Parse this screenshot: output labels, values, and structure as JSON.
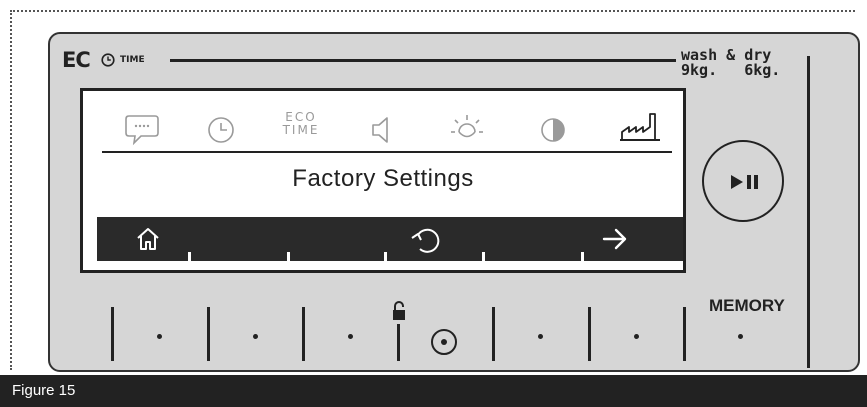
{
  "header": {
    "eco_logo": "EC",
    "eco_time_label": "TIME",
    "wash_dry_title": "wash & dry",
    "capacity_line": "9kg.   6kg."
  },
  "screen": {
    "icons": [
      "chat-bubble-icon",
      "clock-icon",
      "eco-time-icon",
      "speaker-icon",
      "brightness-icon",
      "contrast-icon",
      "factory-icon"
    ],
    "eco_time_icon_text_1": "ECO",
    "eco_time_icon_text_2": "TIME",
    "title": "Factory Settings",
    "bottom_bar_icons": [
      "home-icon",
      "reset-icon",
      "arrow-right-icon"
    ]
  },
  "controls": {
    "play_pause_icon": "play-pause-icon",
    "memory_label": "MEMORY",
    "lock_icon": "lock-icon",
    "center_button_icon": "center-target-icon"
  },
  "caption": "Figure 15"
}
